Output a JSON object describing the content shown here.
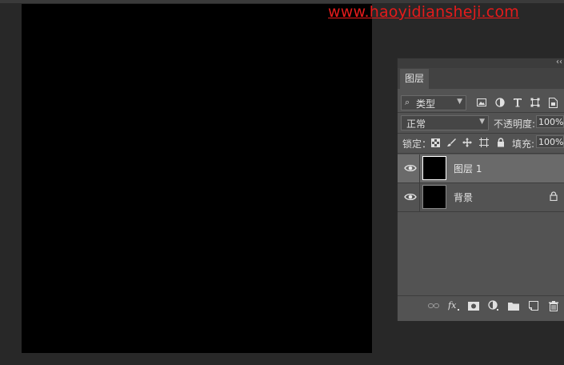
{
  "watermark": {
    "text": "www.haoyidiansheji.com",
    "color": "#e51b1b"
  },
  "canvas": {
    "color": "#000000"
  },
  "layers_panel": {
    "tab_label": "图层",
    "filter": {
      "search_icon": "⌕",
      "label": "类型"
    },
    "blend_mode": "正常",
    "opacity_label": "不透明度:",
    "opacity_value": "100%",
    "lock_label": "锁定：",
    "fill_label": "填充:",
    "fill_value": "100%",
    "layers": [
      {
        "name": "图层 1",
        "selected": true,
        "visible": true,
        "locked": false
      },
      {
        "name": "背景",
        "selected": false,
        "visible": true,
        "locked": true
      }
    ],
    "filter_icons": [
      "image-filter-icon",
      "adjustment-filter-icon",
      "type-filter-icon",
      "shape-filter-icon",
      "smartobject-filter-icon"
    ],
    "lock_icons": [
      "lock-transparent-pixels-icon",
      "lock-image-pixels-icon",
      "lock-position-icon",
      "lock-artboard-icon",
      "lock-all-icon"
    ],
    "bottom_icons": [
      "link-layers-icon",
      "fx-icon",
      "add-mask-icon",
      "adjustment-layer-icon",
      "new-group-icon",
      "new-layer-icon",
      "delete-layer-icon"
    ]
  }
}
